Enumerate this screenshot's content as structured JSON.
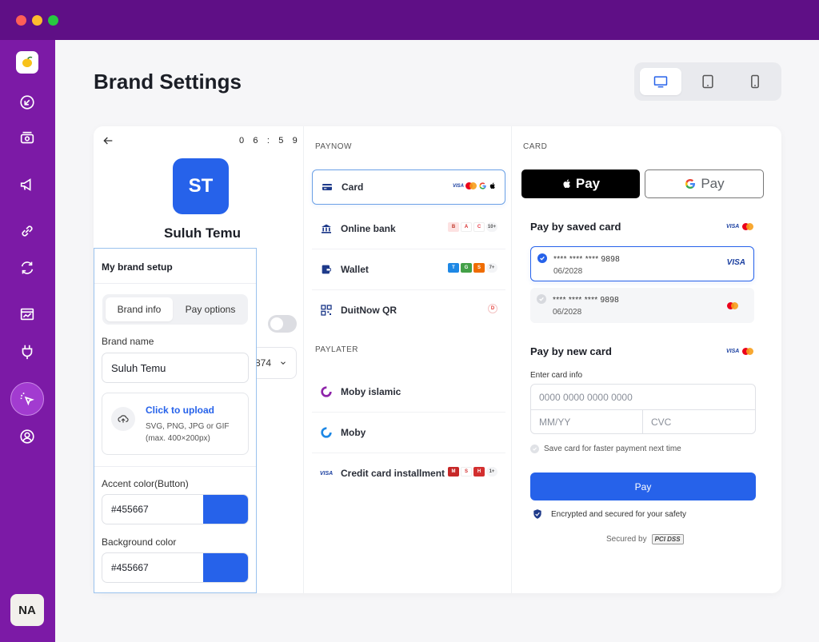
{
  "page": {
    "title": "Brand Settings"
  },
  "device_switch": {
    "options": [
      "desktop",
      "tablet",
      "mobile"
    ],
    "selected": "desktop"
  },
  "preview": {
    "timer": [
      "0",
      "6",
      ":",
      "5",
      "9"
    ],
    "avatar_initials": "ST",
    "brand_display_name": "Suluh Temu",
    "select_value": "874"
  },
  "setup": {
    "title": "My brand setup",
    "tabs": [
      {
        "label": "Brand info"
      },
      {
        "label": "Pay options"
      }
    ],
    "brand_name_label": "Brand name",
    "brand_name_value": "Suluh Temu",
    "upload_title": "Click to upload",
    "upload_desc": "SVG, PNG, JPG or GIF (max. 400×200px)",
    "accent_label": "Accent color(Button)",
    "accent_value": "#455667",
    "accent_swatch": "#2662ea",
    "bg_label": "Background color",
    "bg_value": "#455667",
    "bg_swatch": "#2662ea"
  },
  "payments": {
    "paynow_heading": "PAYNOW",
    "paynow": [
      {
        "label": "Card",
        "icon": "card-icon",
        "active": true
      },
      {
        "label": "Online bank",
        "icon": "bank-icon",
        "more": "10+"
      },
      {
        "label": "Wallet",
        "icon": "wallet-icon",
        "more": "7+"
      },
      {
        "label": "DuitNow QR",
        "icon": "qr-icon"
      }
    ],
    "paylater_heading": "PAYLATER",
    "paylater": [
      {
        "label": "Moby islamic",
        "icon": "moby-islamic-icon"
      },
      {
        "label": "Moby",
        "icon": "moby-icon"
      },
      {
        "label": "Credit card installment",
        "icon": "visa-icon",
        "more": "1+"
      }
    ],
    "card_visa_mark": "VISA"
  },
  "card": {
    "heading": "CARD",
    "apple_pay": "Pay",
    "google_pay": "Pay",
    "saved_title": "Pay by saved card",
    "saved_cards": [
      {
        "number": "**** **** **** 9898",
        "expiry": "06/2028",
        "brand": "VISA",
        "selected": true
      },
      {
        "number": "**** **** **** 9898",
        "expiry": "06/2028",
        "brand": "Mastercard",
        "selected": false
      }
    ],
    "new_title": "Pay by new card",
    "enter_label": "Enter card info",
    "card_number_placeholder": "0000 0000 0000 0000",
    "expiry_placeholder": "MM/YY",
    "cvc_placeholder": "CVC",
    "save_card_label": "Save card for faster payment next time",
    "pay_button": "Pay",
    "secure_note": "Encrypted and secured for your safety",
    "secured_by": "Secured by",
    "secured_badge": "PCI DSS",
    "visa_mark": "VISA"
  },
  "user": {
    "initials": "NA"
  },
  "colors": {
    "brand_purple": "#7c1aa6",
    "titlebar": "#5f0f86",
    "accent_blue": "#2662ea"
  }
}
